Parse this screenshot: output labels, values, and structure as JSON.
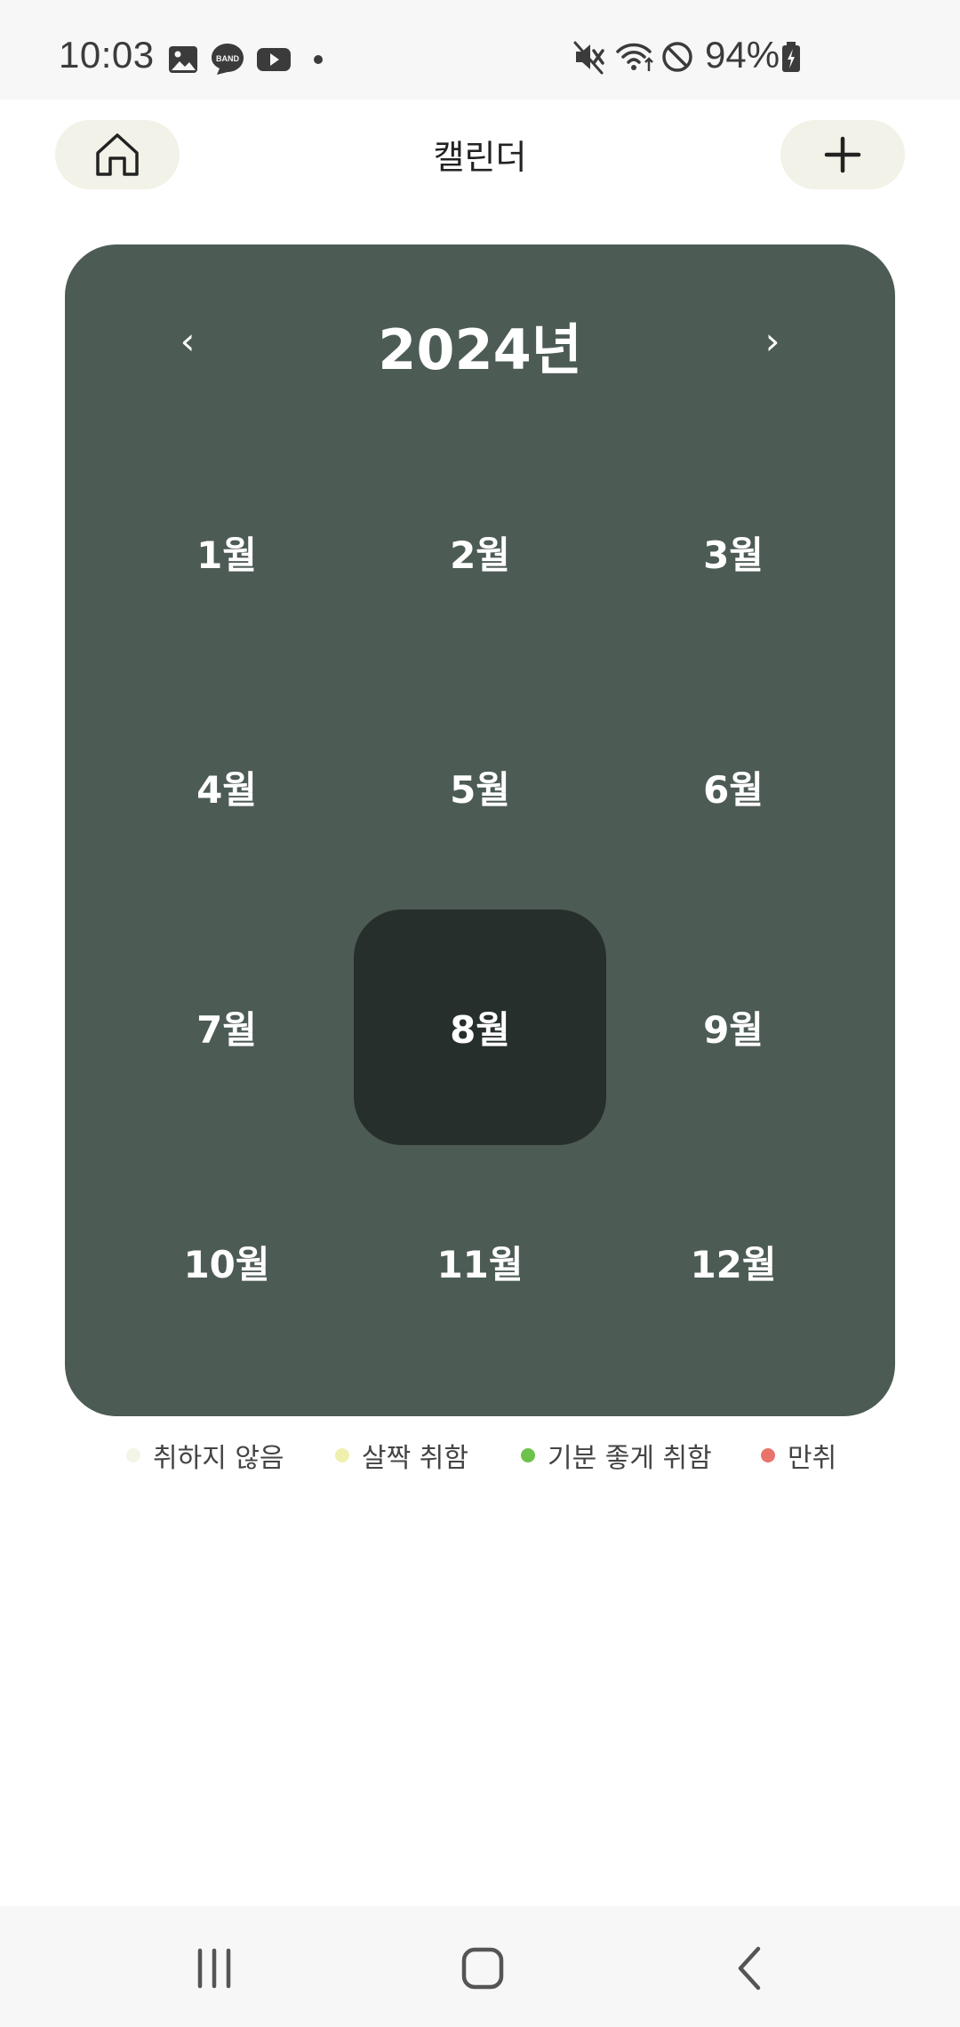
{
  "status_bar": {
    "time": "10:03",
    "battery": "94%",
    "notification_icons": [
      "gallery-icon",
      "band-icon",
      "youtube-icon",
      "dot-icon"
    ],
    "band_label": "BAND",
    "system_icons": [
      "mute-icon",
      "wifi-icon",
      "do-not-disturb-icon",
      "battery-charging-icon"
    ]
  },
  "header": {
    "title": "캘린더",
    "home_icon": "home-icon",
    "add_icon": "plus-icon"
  },
  "calendar": {
    "year_label": "2024년",
    "prev_label": "‹",
    "next_label": "›",
    "selected_month": "8월",
    "months": [
      "1월",
      "2월",
      "3월",
      "4월",
      "5월",
      "6월",
      "7월",
      "8월",
      "9월",
      "10월",
      "11월",
      "12월"
    ]
  },
  "legend": {
    "items": [
      {
        "label": "취하지 않음",
        "color": "#f3f5e6"
      },
      {
        "label": "살짝 취함",
        "color": "#eef0b0"
      },
      {
        "label": "기분 좋게 취함",
        "color": "#6cc24a"
      },
      {
        "label": "만취",
        "color": "#e8736a"
      }
    ]
  },
  "nav_bar": {
    "icons": [
      "recent-apps-icon",
      "home-nav-icon",
      "back-icon"
    ]
  },
  "colors": {
    "card_bg": "#4d5b55",
    "selected_bg": "#272f2c",
    "header_button_bg": "#f2f2e8"
  }
}
